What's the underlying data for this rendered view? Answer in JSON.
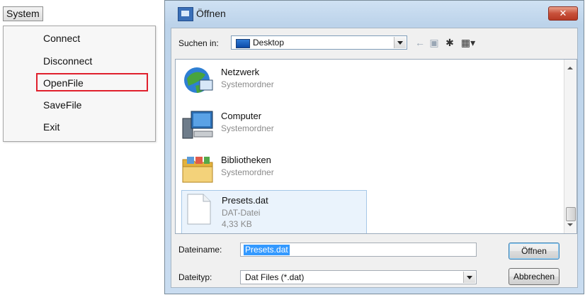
{
  "menu": {
    "button_label": "System",
    "items": [
      "Connect",
      "Disconnect",
      "OpenFile",
      "SaveFile",
      "Exit"
    ],
    "highlighted_index": 2,
    "highlight_color": "#e0202d"
  },
  "dialog": {
    "title": "Öffnen",
    "close_glyph": "✕",
    "look_in_label": "Suchen in:",
    "look_in_value": "Desktop",
    "toolbar_icons": [
      "back-arrow-icon",
      "up-folder-icon",
      "new-folder-icon",
      "view-menu-icon"
    ],
    "items": [
      {
        "name": "Netzwerk",
        "type": "Systemordner",
        "icon": "network-icon"
      },
      {
        "name": "Computer",
        "type": "Systemordner",
        "icon": "computer-icon"
      },
      {
        "name": "Bibliotheken",
        "type": "Systemordner",
        "icon": "libraries-folder-icon"
      },
      {
        "name": "Presets.dat",
        "type": "DAT-Datei",
        "size": "4,33 KB",
        "icon": "file-icon",
        "selected": true
      }
    ],
    "filename_label": "Dateiname:",
    "filename_value": "Presets.dat",
    "filetype_label": "Dateityp:",
    "filetype_value": "Dat Files (*.dat)",
    "open_button": "Öffnen",
    "cancel_button": "Abbrechen",
    "selection_color": "#3399ff"
  }
}
